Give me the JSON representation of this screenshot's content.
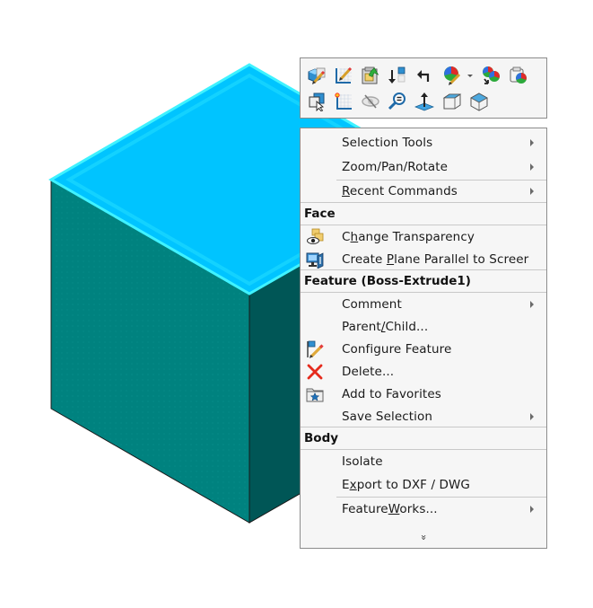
{
  "viewport": {
    "model": {
      "name": "Boss-Extrude1 body",
      "colors": {
        "top_face": "#00c4ff",
        "top_edge_highlight": "#3ff2ff",
        "front_face": "#00827f",
        "side_face": "#005656",
        "edge": "#1a1a1a"
      }
    }
  },
  "toolbar": {
    "row1": [
      {
        "icon": "edit-part-icon",
        "tooltip": "Edit Feature"
      },
      {
        "icon": "edit-sketch-icon",
        "tooltip": "Edit Sketch"
      },
      {
        "icon": "insert-component-icon",
        "tooltip": "Insert"
      },
      {
        "icon": "rollback-icon",
        "tooltip": "Rollback"
      },
      {
        "icon": "undo-arrow-icon",
        "tooltip": "Select Other"
      },
      {
        "icon": "appearance-edit-icon",
        "tooltip": "Appearances",
        "has_dropdown": true
      },
      {
        "icon": "appearance-copy-icon",
        "tooltip": "Copy Appearance"
      },
      {
        "icon": "appearance-paste-icon",
        "tooltip": "Paste Appearance"
      }
    ],
    "row2": [
      {
        "icon": "select-other-icon",
        "tooltip": "Select Other"
      },
      {
        "icon": "sketch-icon",
        "tooltip": "Sketch"
      },
      {
        "icon": "hide-icon",
        "tooltip": "Hide"
      },
      {
        "icon": "zoom-to-selection-icon",
        "tooltip": "Zoom to Selection"
      },
      {
        "icon": "normal-to-icon",
        "tooltip": "Normal To"
      },
      {
        "icon": "view-front-cube-icon",
        "tooltip": "View"
      },
      {
        "icon": "view-iso-cube-icon",
        "tooltip": "View"
      }
    ]
  },
  "menu": {
    "items_top": [
      {
        "label": "Selection Tools",
        "submenu": true
      },
      {
        "label_pre": "Zoom/Pan/Rotate",
        "submenu": true
      },
      {
        "label_u": "R",
        "label_rest": "ecent Commands",
        "submenu": true
      }
    ],
    "face": {
      "header": "Face",
      "items": [
        {
          "label_pre": "C",
          "label_u": "h",
          "label_rest": "ange Transparency",
          "icon": "transparency-icon"
        },
        {
          "label_pre": "Create ",
          "label_u": "P",
          "label_rest": "lane Parallel to Screer",
          "icon": "plane-parallel-screen-icon"
        }
      ]
    },
    "feature": {
      "header": "Feature (Boss-Extrude1)",
      "items": [
        {
          "label": "Comment",
          "submenu": true
        },
        {
          "label_pre": "Parent",
          "label_u": "/",
          "label_rest": "Child...",
          "submenu": false
        },
        {
          "label": "Configure Feature",
          "icon": "configure-feature-icon"
        },
        {
          "label": "Delete...",
          "icon": "delete-icon"
        },
        {
          "label": "Add to Favorites",
          "icon": "favorites-folder-icon"
        },
        {
          "label": "Save Selection",
          "submenu": true
        }
      ]
    },
    "body": {
      "header": "Body",
      "items": [
        {
          "label": "Isolate"
        },
        {
          "label_pre": "E",
          "label_u": "x",
          "label_rest": "port to DXF / DWG"
        },
        {
          "label_pre": "Feature",
          "label_u": "W",
          "label_rest": "orks...",
          "submenu": true
        }
      ]
    },
    "expand_glyph": "»"
  }
}
